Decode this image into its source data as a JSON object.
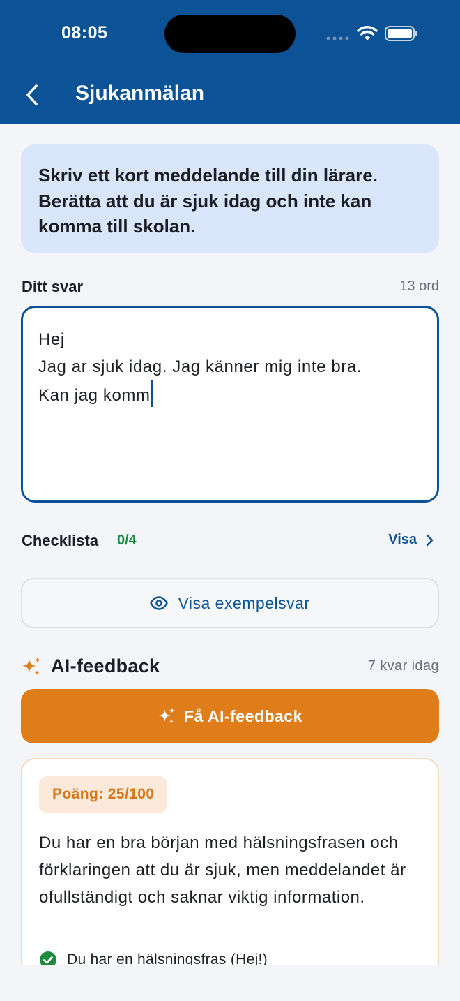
{
  "status_bar": {
    "time": "08:05"
  },
  "nav": {
    "title": "Sjukanmälan",
    "back_icon": "chevron-left-icon"
  },
  "prompt": {
    "text": "Skriv ett kort meddelande till din lärare. Berätta att du är sjuk idag och inte kan komma till skolan."
  },
  "answer": {
    "label": "Ditt svar",
    "word_count": "13 ord",
    "lines": [
      "Hej",
      "Jag ar sjuk idag. Jag känner mig inte bra.",
      "Kan jag komm"
    ]
  },
  "checklist": {
    "label": "Checklista",
    "count": "0/4",
    "show_label": "Visa"
  },
  "example": {
    "button_label": "Visa exempelsvar",
    "icon": "eye-icon"
  },
  "ai_feedback": {
    "title": "AI-feedback",
    "remaining": "7 kvar idag",
    "button_label": "Få AI-feedback",
    "icon": "sparkles-icon"
  },
  "feedback": {
    "score": "Poäng: 25/100",
    "text": "Du har en bra början med hälsningsfrasen och förklaringen att du är sjuk, men meddelandet är ofullständigt och saknar viktig information.",
    "items": [
      {
        "text": "Du har en hälsningsfras (Hej!)",
        "icon": "check-circle-icon"
      }
    ]
  },
  "colors": {
    "primary": "#0b5396",
    "accent": "#e07d1b",
    "success": "#1f8a3d",
    "prompt_bg": "#d8e5fb"
  }
}
